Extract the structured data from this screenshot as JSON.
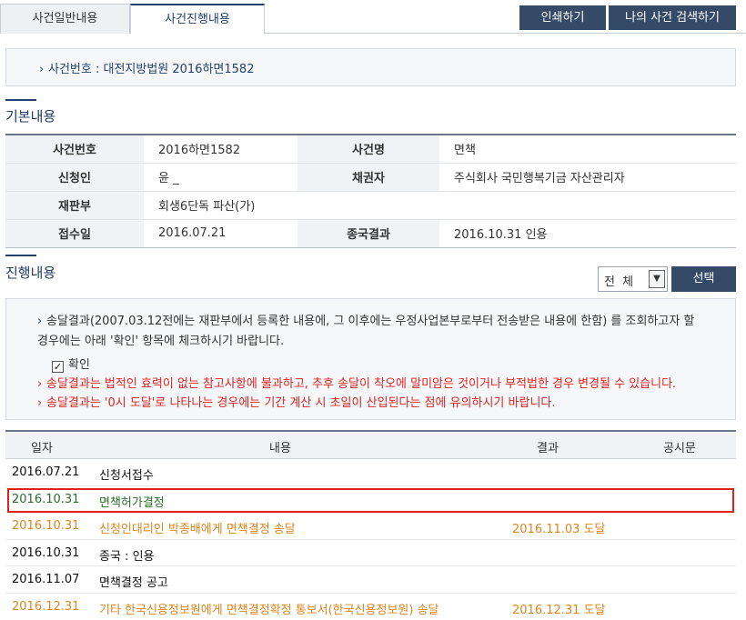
{
  "tabs": {
    "general": "사건일반내용",
    "progress": "사건진행내용"
  },
  "top_buttons": {
    "print": "인쇄하기",
    "my_case_search": "나의 사건 검색하기"
  },
  "case_number_line": "사건번호 : 대전지방법원 2016하면1582",
  "basic_section": {
    "title": "기본내용",
    "rows": [
      {
        "h1": "사건번호",
        "v1": "2016하면1582",
        "h2": "사건명",
        "v2": "면책"
      },
      {
        "h1": "신청인",
        "v1": "윤 _",
        "h2": "채권자",
        "v2": "주식회사 국민행복기금 자산관리자"
      },
      {
        "h1": "재판부",
        "v1": "회생6단독 파산(가)",
        "h2": "",
        "v2": ""
      },
      {
        "h1": "접수일",
        "v1": "2016.07.21",
        "h2": "종국결과",
        "v2": "2016.10.31 인용"
      }
    ]
  },
  "progress_section": {
    "title": "진행내용",
    "filter_value": "전 체",
    "filter_button": "선택",
    "notice": {
      "line1": "송달결과(2007.03.12전에는 재판부에서 등록한 내용에, 그 이후에는 우정사업본부로부터 전송받은 내용에 한함) 를 조회하고자 할 경우에는 아래 '확인' 항목에 체크하시기 바랍니다.",
      "check_label": "확인",
      "warn1": "송달결과는 법적인 효력이 없는 참고사항에 불과하고, 추후 송달이 착오에 말미암은 것이거나 부적법한 경우 변경될 수 있습니다.",
      "warn2": "송달결과는 '0시 도달'로 나타나는 경우에는 기간 계산 시 초일이 산입된다는 점에 유의하시기 바랍니다."
    },
    "columns": {
      "date": "일자",
      "content": "내용",
      "result": "결과",
      "notice": "공시문"
    },
    "rows": [
      {
        "date": "2016.07.21",
        "content": "신청서접수",
        "result": "",
        "style": "dark"
      },
      {
        "date": "2016.10.31",
        "content": "면책허가결정",
        "result": "",
        "style": "green",
        "highlighted": true
      },
      {
        "date": "2016.10.31",
        "content": "신청인대리인 박종배에게 면책결정 송달",
        "result": "2016.11.03 도달",
        "style": "orange"
      },
      {
        "date": "2016.10.31",
        "content": "종국 : 인용",
        "result": "",
        "style": "dark"
      },
      {
        "date": "2016.11.07",
        "content": "면책결정 공고",
        "result": "",
        "style": "dark"
      },
      {
        "date": "2016.12.31",
        "content": "기타 한국신용정보원에게 면책결정확정 통보서(한국신용정보원) 송달",
        "result": "2016.12.31 도달",
        "style": "orange"
      }
    ]
  },
  "colors": {
    "navy": "#354a67",
    "highlight_border": "#e02020",
    "orange": "#e0841c",
    "green": "#2b6b2b",
    "warning_red": "#e22222"
  }
}
